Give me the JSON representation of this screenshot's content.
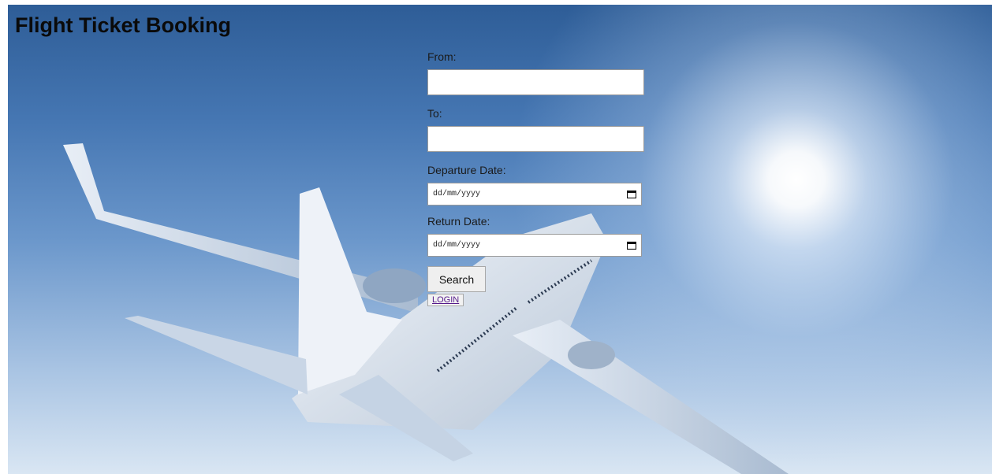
{
  "page": {
    "title": "Flight Ticket Booking"
  },
  "form": {
    "from_label": "From:",
    "from_value": "",
    "to_label": "To:",
    "to_value": "",
    "departure_label": "Departure Date:",
    "departure_placeholder": "dd/mm/yyyy",
    "return_label": "Return Date:",
    "return_placeholder": "dd/mm/yyyy",
    "search_label": "Search",
    "login_label": "LOGIN"
  },
  "icons": {
    "calendar": "calendar-icon"
  },
  "colors": {
    "sky_top": "#2e5d97",
    "sky_bottom": "#d9e6f3",
    "link": "#551a8b"
  }
}
